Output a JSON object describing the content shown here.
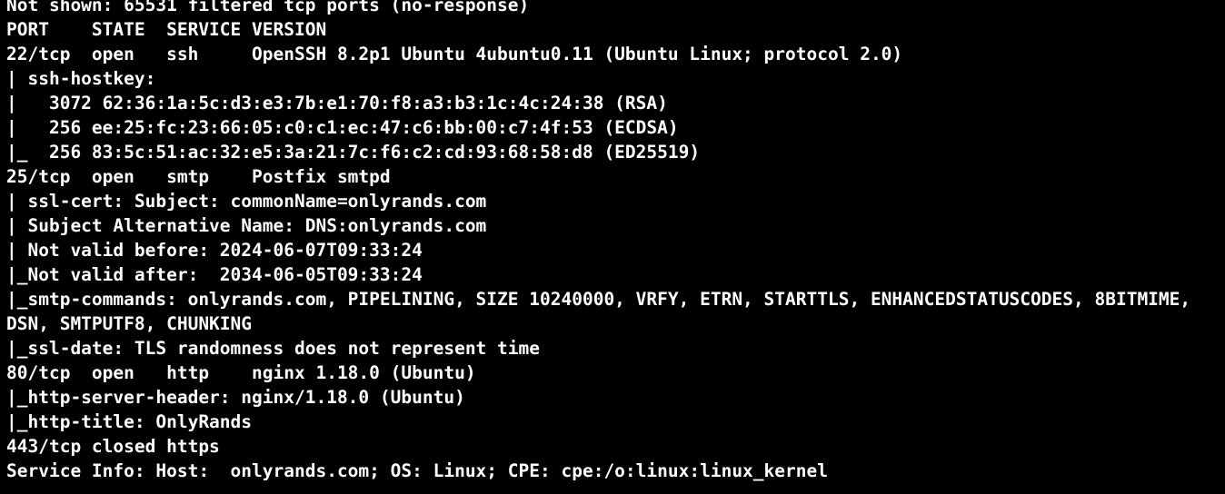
{
  "terminal": {
    "background_color": "#000000",
    "text_color": "#ffffff",
    "lines": [
      "Not shown: 65531 filtered tcp ports (no-response)",
      "PORT    STATE  SERVICE VERSION",
      "22/tcp  open   ssh     OpenSSH 8.2p1 Ubuntu 4ubuntu0.11 (Ubuntu Linux; protocol 2.0)",
      "| ssh-hostkey:",
      "|   3072 62:36:1a:5c:d3:e3:7b:e1:70:f8:a3:b3:1c:4c:24:38 (RSA)",
      "|   256 ee:25:fc:23:66:05:c0:c1:ec:47:c6:bb:00:c7:4f:53 (ECDSA)",
      "|_  256 83:5c:51:ac:32:e5:3a:21:7c:f6:c2:cd:93:68:58:d8 (ED25519)",
      "25/tcp  open   smtp    Postfix smtpd",
      "| ssl-cert: Subject: commonName=onlyrands.com",
      "| Subject Alternative Name: DNS:onlyrands.com",
      "| Not valid before: 2024-06-07T09:33:24",
      "|_Not valid after:  2034-06-05T09:33:24",
      "|_smtp-commands: onlyrands.com, PIPELINING, SIZE 10240000, VRFY, ETRN, STARTTLS, ENHANCEDSTATUSCODES, 8BITMIME,",
      "DSN, SMTPUTF8, CHUNKING",
      "|_ssl-date: TLS randomness does not represent time",
      "80/tcp  open   http    nginx 1.18.0 (Ubuntu)",
      "|_http-server-header: nginx/1.18.0 (Ubuntu)",
      "|_http-title: OnlyRands",
      "443/tcp closed https",
      "Service Info: Host:  onlyrands.com; OS: Linux; CPE: cpe:/o:linux:linux_kernel"
    ]
  }
}
